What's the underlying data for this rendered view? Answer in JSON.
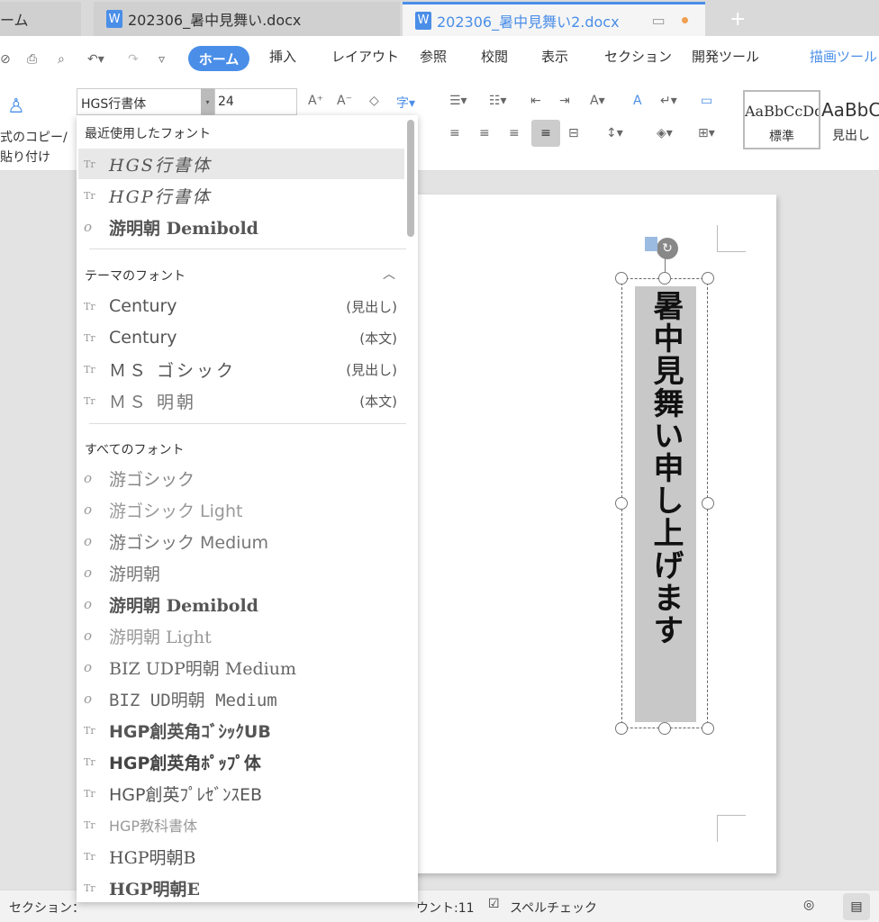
{
  "tabs": [
    {
      "label": "ーム"
    },
    {
      "label": "202306_暑中見舞い.docx"
    },
    {
      "label": "202306_暑中見舞い2.docx",
      "active": true
    }
  ],
  "menu": {
    "home": "ホーム",
    "items": [
      "挿入",
      "レイアウト",
      "参照",
      "校閲",
      "表示",
      "セクション",
      "開発ツール"
    ],
    "drawing": "描画ツール"
  },
  "toolbar": {
    "font": "HGS行書体",
    "size": "24",
    "format_painter": "式のコピー/",
    "paste": "貼り付け"
  },
  "styles": [
    {
      "sample": "AaBbCcDd",
      "name": "標準"
    },
    {
      "sample": "AaBbC",
      "name": "見出し"
    }
  ],
  "document": {
    "text": "暑中見舞い申し上げます"
  },
  "font_dropdown": {
    "recent_label": "最近使用したフォント",
    "recent": [
      {
        "name": "HGS行書体",
        "icon": "truetype-icon",
        "selected": true
      },
      {
        "name": "HGP行書体",
        "icon": "truetype-icon"
      },
      {
        "name": "游明朝 Demibold",
        "icon": "opentype-icon"
      }
    ],
    "theme_label": "テーマのフォント",
    "theme": [
      {
        "name": "Century",
        "tag": "(見出し)"
      },
      {
        "name": "Century",
        "tag": "(本文)"
      },
      {
        "name": "ＭＳ ゴシック",
        "tag": "(見出し)"
      },
      {
        "name": "ＭＳ 明朝",
        "tag": "(本文)"
      }
    ],
    "all_label": "すべてのフォント",
    "all": [
      {
        "name": "游ゴシック",
        "icon": "opentype-icon"
      },
      {
        "name": "游ゴシック Light",
        "icon": "opentype-icon"
      },
      {
        "name": "游ゴシック Medium",
        "icon": "opentype-icon"
      },
      {
        "name": "游明朝",
        "icon": "opentype-icon"
      },
      {
        "name": "游明朝 Demibold",
        "icon": "opentype-icon"
      },
      {
        "name": "游明朝 Light",
        "icon": "opentype-icon"
      },
      {
        "name": "BIZ UDP明朝 Medium",
        "icon": "opentype-icon"
      },
      {
        "name": "BIZ UD明朝 Medium",
        "icon": "opentype-icon"
      },
      {
        "name": "HGP創英角ｺﾞｼｯｸUB",
        "icon": "truetype-icon"
      },
      {
        "name": "HGP創英角ﾎﾟｯﾌﾟ体",
        "icon": "truetype-icon"
      },
      {
        "name": "HGP創英ﾌﾟﾚｾﾞﾝｽEB",
        "icon": "truetype-icon"
      },
      {
        "name": "HGP教科書体",
        "icon": "truetype-icon"
      },
      {
        "name": "HGP明朝B",
        "icon": "truetype-icon"
      },
      {
        "name": "HGP明朝E",
        "icon": "truetype-icon"
      }
    ]
  },
  "status": {
    "section": "セクション：",
    "word_count": "ウント:11",
    "spellcheck": "スペルチェック"
  },
  "colors": {
    "accent": "#4a8ee8",
    "modified_dot": "#f0a050"
  }
}
